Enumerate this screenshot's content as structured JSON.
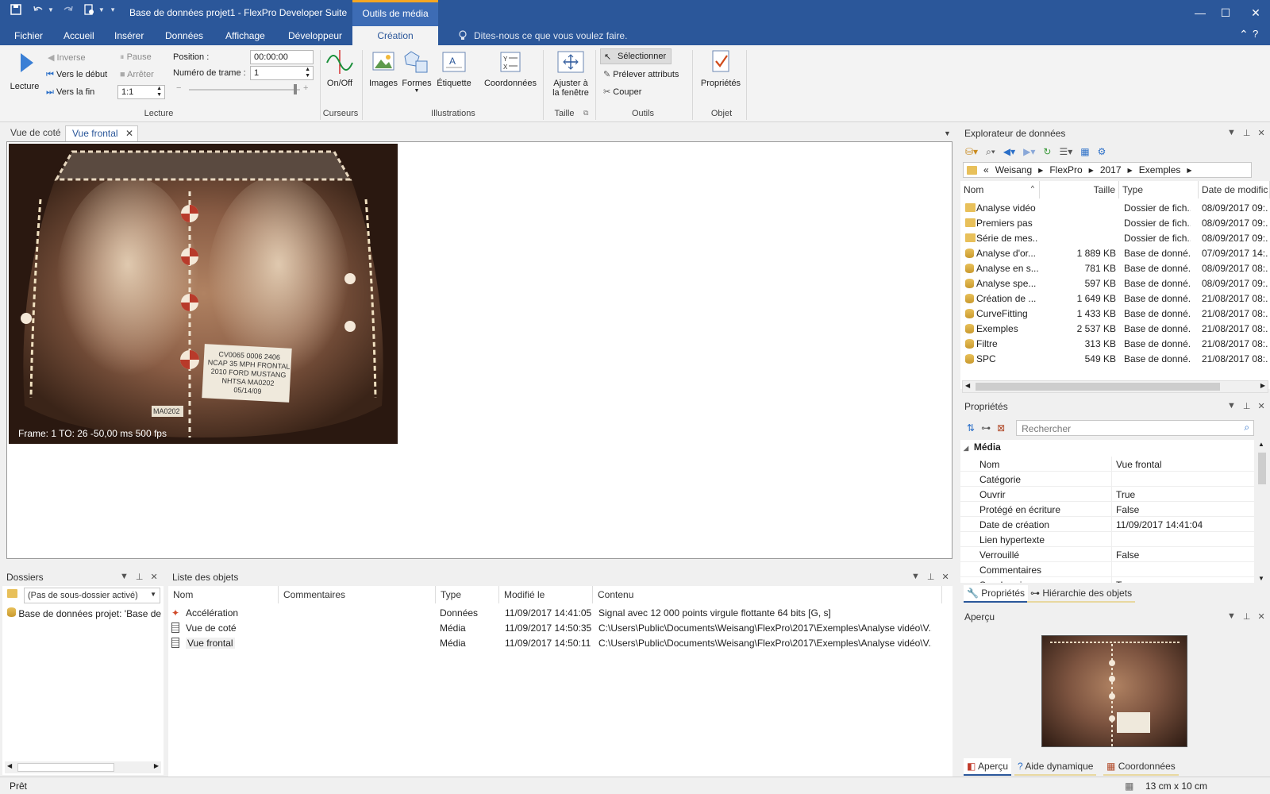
{
  "titlebar": {
    "title": "Base de données projet1 - FlexPro Developer Suite",
    "context_tab": "Outils de média"
  },
  "menu": {
    "items": [
      "Fichier",
      "Accueil",
      "Insérer",
      "Données",
      "Affichage",
      "Développeur"
    ],
    "active_tab": "Création",
    "tell_me": "Dites-nous ce que vous voulez faire."
  },
  "ribbon": {
    "lecture": {
      "play": "Lecture",
      "inverse": "Inverse",
      "vers_debut": "Vers le début",
      "vers_fin": "Vers la fin",
      "pause": "Pause",
      "arreter": "Arrêter",
      "speed": "1:1",
      "position_label": "Position :",
      "position_value": "00:00:00",
      "frame_label": "Numéro de trame :",
      "frame_value": "1",
      "group": "Lecture"
    },
    "curseurs": {
      "onoff": "On/Off",
      "group": "Curseurs"
    },
    "illustrations": {
      "images": "Images",
      "formes": "Formes",
      "etiquette": "Étiquette",
      "group": "Illustrations"
    },
    "coordonnees": {
      "label": "Coordonnées"
    },
    "taille": {
      "ajuster1": "Ajuster à",
      "ajuster2": "la fenêtre",
      "group": "Taille"
    },
    "outils": {
      "selectionner": "Sélectionner",
      "prelever": "Prélever attributs",
      "couper": "Couper",
      "group": "Outils"
    },
    "objet": {
      "proprietes": "Propriétés",
      "group": "Objet"
    }
  },
  "doctabs": {
    "tab1": "Vue de coté",
    "tab2": "Vue frontal"
  },
  "media": {
    "overlay": "Frame: 1     TO: 26  -50,00 ms  500 fps",
    "placard": [
      "CV0065 0006 2406",
      "NCAP 35 MPH FRONTAL",
      "2010 FORD MUSTANG",
      "NHTSA MA0202",
      "05/14/09"
    ],
    "tag": "MA0202"
  },
  "explorer": {
    "title": "Explorateur de données",
    "breadcrumb": [
      "«",
      "Weisang",
      "FlexPro",
      "2017",
      "Exemples"
    ],
    "columns": [
      "Nom",
      "Taille",
      "Type",
      "Date de modific"
    ],
    "rows": [
      {
        "name": "Analyse vidéo",
        "size": "",
        "type": "Dossier de fich...",
        "date": "08/09/2017 09:...",
        "kind": "folder"
      },
      {
        "name": "Premiers pas",
        "size": "",
        "type": "Dossier de fich...",
        "date": "08/09/2017 09:...",
        "kind": "folder"
      },
      {
        "name": "Série de mes...",
        "size": "",
        "type": "Dossier de fich...",
        "date": "08/09/2017 09:...",
        "kind": "folder"
      },
      {
        "name": "Analyse d'or...",
        "size": "1 889 KB",
        "type": "Base de donné...",
        "date": "07/09/2017 14:...",
        "kind": "db"
      },
      {
        "name": "Analyse en s...",
        "size": "781 KB",
        "type": "Base de donné...",
        "date": "08/09/2017 08:...",
        "kind": "db"
      },
      {
        "name": "Analyse spe...",
        "size": "597 KB",
        "type": "Base de donné...",
        "date": "08/09/2017 09:...",
        "kind": "db"
      },
      {
        "name": "Création de ...",
        "size": "1 649 KB",
        "type": "Base de donné...",
        "date": "21/08/2017 08:...",
        "kind": "db"
      },
      {
        "name": "CurveFitting",
        "size": "1 433 KB",
        "type": "Base de donné...",
        "date": "21/08/2017 08:...",
        "kind": "db"
      },
      {
        "name": "Exemples",
        "size": "2 537 KB",
        "type": "Base de donné...",
        "date": "21/08/2017 08:...",
        "kind": "db"
      },
      {
        "name": "Filtre",
        "size": "313 KB",
        "type": "Base de donné...",
        "date": "21/08/2017 08:...",
        "kind": "db"
      },
      {
        "name": "SPC",
        "size": "549 KB",
        "type": "Base de donné...",
        "date": "21/08/2017 08:...",
        "kind": "db"
      }
    ]
  },
  "properties": {
    "title": "Propriétés",
    "search_placeholder": "Rechercher",
    "section": "Média",
    "rows": [
      {
        "k": "Nom",
        "v": "Vue frontal"
      },
      {
        "k": "Catégorie",
        "v": ""
      },
      {
        "k": "Ouvrir",
        "v": "True"
      },
      {
        "k": "Protégé en écriture",
        "v": "False"
      },
      {
        "k": "Date de création",
        "v": "11/09/2017 14:41:04"
      },
      {
        "k": "Lien hypertexte",
        "v": ""
      },
      {
        "k": "Verrouillé",
        "v": "False"
      },
      {
        "k": "Commentaires",
        "v": ""
      },
      {
        "k": "Synchroniser curseur",
        "v": "True"
      }
    ],
    "tab1": "Propriétés",
    "tab2": "Hiérarchie des objets"
  },
  "apercu": {
    "title": "Aperçu",
    "tab1": "Aperçu",
    "tab2": "Aide dynamique",
    "tab3": "Coordonnées"
  },
  "dossiers": {
    "title": "Dossiers",
    "select": "(Pas de sous-dossier activé)",
    "item": "Base de données projet: 'Base de d"
  },
  "objlist": {
    "title": "Liste des objets",
    "columns": [
      "Nom",
      "Commentaires",
      "Type",
      "Modifié le",
      "Contenu"
    ],
    "rows": [
      {
        "name": "Accélération",
        "type": "Données",
        "date": "11/09/2017 14:41:05",
        "content": "Signal avec 12 000 points virgule flottante 64 bits [G, s]",
        "kind": "data"
      },
      {
        "name": "Vue de coté",
        "type": "Média",
        "date": "11/09/2017 14:50:35",
        "content": "C:\\Users\\Public\\Documents\\Weisang\\FlexPro\\2017\\Exemples\\Analyse vidéo\\V...",
        "kind": "media"
      },
      {
        "name": "Vue frontal",
        "type": "Média",
        "date": "11/09/2017 14:50:11",
        "content": "C:\\Users\\Public\\Documents\\Weisang\\FlexPro\\2017\\Exemples\\Analyse vidéo\\V...",
        "kind": "media"
      }
    ]
  },
  "status": {
    "left": "Prêt",
    "right": "13 cm x 10 cm"
  },
  "colors": {
    "accent": "#2b579a",
    "context": "#3d6cb5",
    "orange": "#f5a623"
  }
}
